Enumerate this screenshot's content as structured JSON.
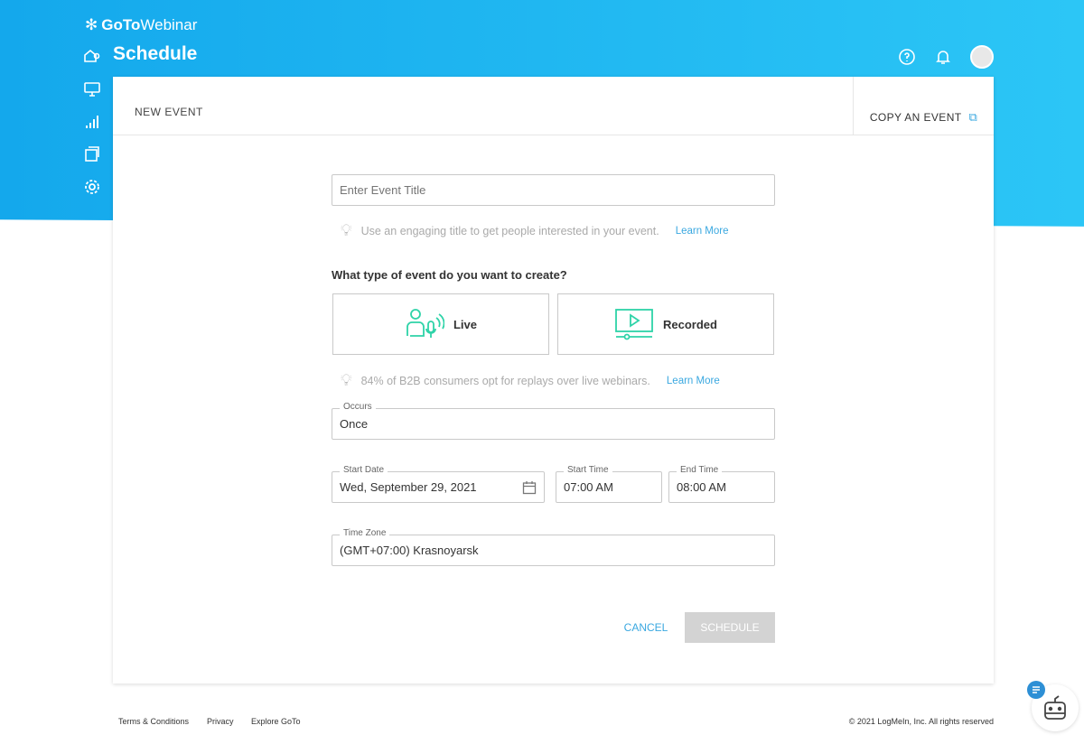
{
  "brand": {
    "bold": "GoTo",
    "rest": "Webinar"
  },
  "header": {
    "title": "Schedule"
  },
  "card": {
    "title": "NEW EVENT",
    "copy_label": "COPY AN EVENT"
  },
  "form": {
    "title_placeholder": "Enter Event Title",
    "title_hint": "Use an engaging title to get people interested in your event.",
    "learn_more": "Learn More",
    "type_question": "What type of event do you want to create?",
    "types": [
      "Live",
      "Recorded"
    ],
    "type_hint": "84% of B2B consumers opt for replays over live webinars.",
    "occurs_label": "Occurs",
    "occurs_value": "Once",
    "start_date_label": "Start Date",
    "start_date_value": "Wed, September 29, 2021",
    "start_time_label": "Start Time",
    "start_time_value": "07:00 AM",
    "end_time_label": "End Time",
    "end_time_value": "08:00 AM",
    "tz_label": "Time Zone",
    "tz_value": "(GMT+07:00) Krasnoyarsk",
    "cancel": "CANCEL",
    "schedule": "SCHEDULE"
  },
  "footer": {
    "links": [
      "Terms & Conditions",
      "Privacy",
      "Explore GoTo"
    ],
    "copyright": "© 2021 LogMeIn, Inc. All rights reserved"
  }
}
